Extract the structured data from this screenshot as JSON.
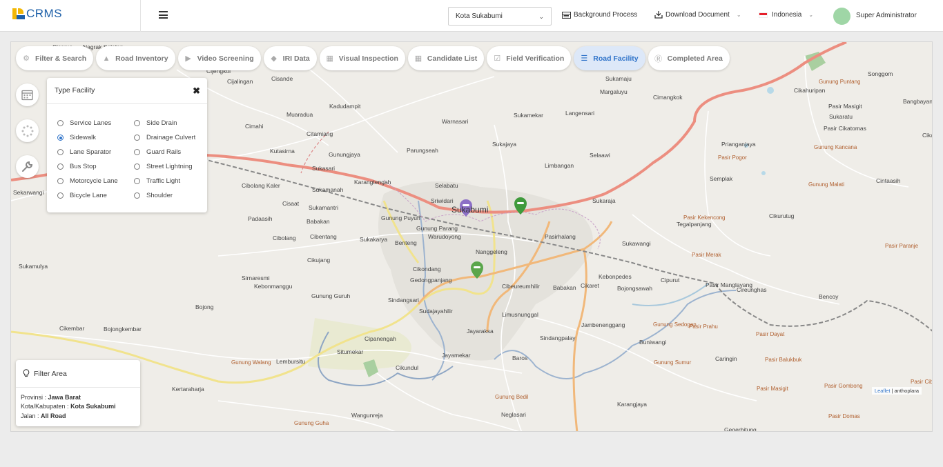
{
  "app": {
    "logo_text": "CRMS"
  },
  "topbar": {
    "city_select": "Kota Sukabumi",
    "background_process": "Background Process",
    "download_document": "Download Document",
    "language": "Indonesia",
    "user_name": "Super Administrator"
  },
  "tabs": [
    {
      "label": "Filter & Search",
      "icon": "gear-icon",
      "active": false
    },
    {
      "label": "Road Inventory",
      "icon": "road-icon",
      "active": false
    },
    {
      "label": "Video Screening",
      "icon": "video-icon",
      "active": false
    },
    {
      "label": "IRI Data",
      "icon": "car-icon",
      "active": false
    },
    {
      "label": "Visual Inspection",
      "icon": "image-icon",
      "active": false
    },
    {
      "label": "Candidate List",
      "icon": "map-icon",
      "active": false
    },
    {
      "label": "Field Verification",
      "icon": "checkbox-icon",
      "active": false
    },
    {
      "label": "Road Facility",
      "icon": "signpost-icon",
      "active": true
    },
    {
      "label": "Completed Area",
      "icon": "r-circle-icon",
      "active": false
    }
  ],
  "facility_panel": {
    "title": "Type Facility",
    "options_left": [
      "Service Lanes",
      "Sidewalk",
      "Lane Sparator",
      "Bus Stop",
      "Motorcycle Lane",
      "Bicycle Lane"
    ],
    "options_right": [
      "Side Drain",
      "Drainage Culvert",
      "Guard Rails",
      "Street Lightning",
      "Traffic Light",
      "Shoulder"
    ],
    "selected": "Sidewalk"
  },
  "filter_area": {
    "title": "Filter Area",
    "provinsi_label": "Provinsi : ",
    "provinsi_value": "Jawa Barat",
    "kota_label": "Kota/Kabupaten : ",
    "kota_value": "Kota Sukabumi",
    "jalan_label": "Jalan : ",
    "jalan_value": "All Road"
  },
  "map": {
    "attribution_link": "Leaflet",
    "attribution_rest": " | anthoplara",
    "places": [
      [
        "Cisarua",
        60,
        2
      ],
      [
        "Nagrak Selatan",
        104,
        2
      ],
      [
        "Cijengkol",
        283,
        37
      ],
      [
        "Cijalingan",
        313,
        52
      ],
      [
        "Cisande",
        377,
        48
      ],
      [
        "Muaradua",
        399,
        100
      ],
      [
        "Kadudampit",
        461,
        88
      ],
      [
        "Cimahi",
        339,
        117
      ],
      [
        "Citamiang",
        428,
        128
      ],
      [
        "Kutasirna",
        375,
        153
      ],
      [
        "Warnasari",
        624,
        110
      ],
      [
        "Sukamaju",
        861,
        48
      ],
      [
        "Margaluyu",
        853,
        67
      ],
      [
        "Cimangkok",
        930,
        75
      ],
      [
        "Cikahuripan",
        1134,
        65
      ],
      [
        "Songgom",
        1241,
        41
      ],
      [
        "Bangbayang",
        1292,
        81
      ],
      [
        "Pasir Masigit",
        1184,
        88
      ],
      [
        "Sukaratu",
        1185,
        103
      ],
      [
        "Pasir Cikatomas",
        1177,
        120
      ],
      [
        "Sukamekar",
        728,
        101
      ],
      [
        "Langensari",
        803,
        98
      ],
      [
        "Sukajaya",
        697,
        143
      ],
      [
        "Parungseah",
        573,
        152
      ],
      [
        "Gunungjaya",
        460,
        158
      ],
      [
        "Sukasari",
        436,
        178
      ],
      [
        "Limbangan",
        773,
        174
      ],
      [
        "Selaawi",
        838,
        159
      ],
      [
        "Prianganjaya",
        1029,
        143
      ],
      [
        "Cikancana",
        1320,
        130
      ],
      [
        "Karangtengah",
        497,
        198
      ],
      [
        "Sukamanah",
        436,
        209
      ],
      [
        "Selabatu",
        614,
        203
      ],
      [
        "Cibolang Kaler",
        334,
        203
      ],
      [
        "Sekarwangi",
        3,
        213
      ],
      [
        "Semplak",
        1012,
        193
      ],
      [
        "Cintaasih",
        1253,
        196
      ],
      [
        "Sriwidari",
        608,
        225
      ],
      [
        "Sukaraja",
        842,
        225
      ],
      [
        "Cisaat",
        393,
        229
      ],
      [
        "Sukamantri",
        431,
        235
      ],
      [
        "Padaasih",
        343,
        251
      ],
      [
        "Babakan",
        428,
        255
      ],
      [
        "Gunung Puyuh",
        536,
        250
      ],
      [
        "Gunung Parang",
        587,
        265
      ],
      [
        "Cikurutug",
        1098,
        247
      ],
      [
        "Tegalpanjang",
        964,
        259
      ],
      [
        "Cibolang",
        379,
        279
      ],
      [
        "Cibentang",
        433,
        277
      ],
      [
        "Sukakarya",
        505,
        281
      ],
      [
        "Benteng",
        556,
        286
      ],
      [
        "Warudoyong",
        604,
        277
      ],
      [
        "Pasirhalang",
        773,
        277
      ],
      [
        "Sukawangi",
        885,
        287
      ],
      [
        "Cikujang",
        429,
        311
      ],
      [
        "Nanggeleng",
        673,
        299
      ],
      [
        "Sukamulya",
        11,
        320
      ],
      [
        "Cikondang",
        582,
        324
      ],
      [
        "Sirnaresmi",
        334,
        337
      ],
      [
        "Gedongpanjang",
        578,
        340
      ],
      [
        "Kebonmanggu",
        352,
        349
      ],
      [
        "Kebonpedes",
        851,
        335
      ],
      [
        "Cipurut",
        941,
        340
      ],
      [
        "Pasir Manglayang",
        1006,
        347
      ],
      [
        "Cireunghas",
        1051,
        354
      ],
      [
        "Cibeureumhilir",
        711,
        349
      ],
      [
        "Babakan",
        785,
        351
      ],
      [
        "Cikaret",
        825,
        348
      ],
      [
        "Bojongsawah",
        878,
        352
      ],
      [
        "Gunung Guruh",
        435,
        363
      ],
      [
        "Sindangsari",
        546,
        369
      ],
      [
        "Bojong",
        267,
        379
      ],
      [
        "Sudajayahilir",
        591,
        385
      ],
      [
        "Limusnunggal",
        711,
        390
      ],
      [
        "Bencoy",
        1170,
        364
      ],
      [
        "Jambenenggang",
        826,
        405
      ],
      [
        "Cikembar",
        70,
        410
      ],
      [
        "Bojongkembar",
        134,
        411
      ],
      [
        "Jayaraksa",
        660,
        414
      ],
      [
        "Sindangpalay",
        766,
        424
      ],
      [
        "Cipanengah",
        512,
        425
      ],
      [
        "Buniwangi",
        910,
        430
      ],
      [
        "Situmekar",
        472,
        444
      ],
      [
        "Jayamekar",
        624,
        449
      ],
      [
        "Baros",
        726,
        453
      ],
      [
        "Caringin",
        1020,
        454
      ],
      [
        "Lembursitu",
        384,
        458
      ],
      [
        "Cikundul",
        557,
        467
      ],
      [
        "Kertaraharja",
        233,
        498
      ],
      [
        "Karangjaya",
        878,
        520
      ],
      [
        "Wangunreja",
        493,
        536
      ],
      [
        "Neglasari",
        710,
        535
      ],
      [
        "Gegerbitung",
        1033,
        557
      ]
    ],
    "peaks": [
      [
        "Gunung Puntang",
        1170,
        53
      ],
      [
        "Pasir Pogor",
        1024,
        163
      ],
      [
        "Gunung Kancana",
        1163,
        148
      ],
      [
        "Gunung Malati",
        1155,
        202
      ],
      [
        "Pasir Kekencong",
        974,
        250
      ],
      [
        "Pasir Paranje",
        1266,
        291
      ],
      [
        "Pasir Merak",
        986,
        304
      ],
      [
        "Gunung Sedogan",
        930,
        405
      ],
      [
        "Pasir Prahu",
        982,
        408
      ],
      [
        "Pasir Dayat",
        1079,
        419
      ],
      [
        "Pasir Balukbuk",
        1092,
        456
      ],
      [
        "Gunung Sumur",
        931,
        460
      ],
      [
        "Pasir Masigit",
        1080,
        498
      ],
      [
        "Pasir Gombong",
        1178,
        494
      ],
      [
        "Pasir Cibeureum",
        1303,
        488
      ],
      [
        "Gunung Walang",
        319,
        460
      ],
      [
        "Gunung Bedil",
        701,
        510
      ],
      [
        "Pasir Domas",
        1184,
        538
      ],
      [
        "Gunung Guha",
        410,
        548
      ]
    ],
    "city_label": "Sukabumi"
  }
}
